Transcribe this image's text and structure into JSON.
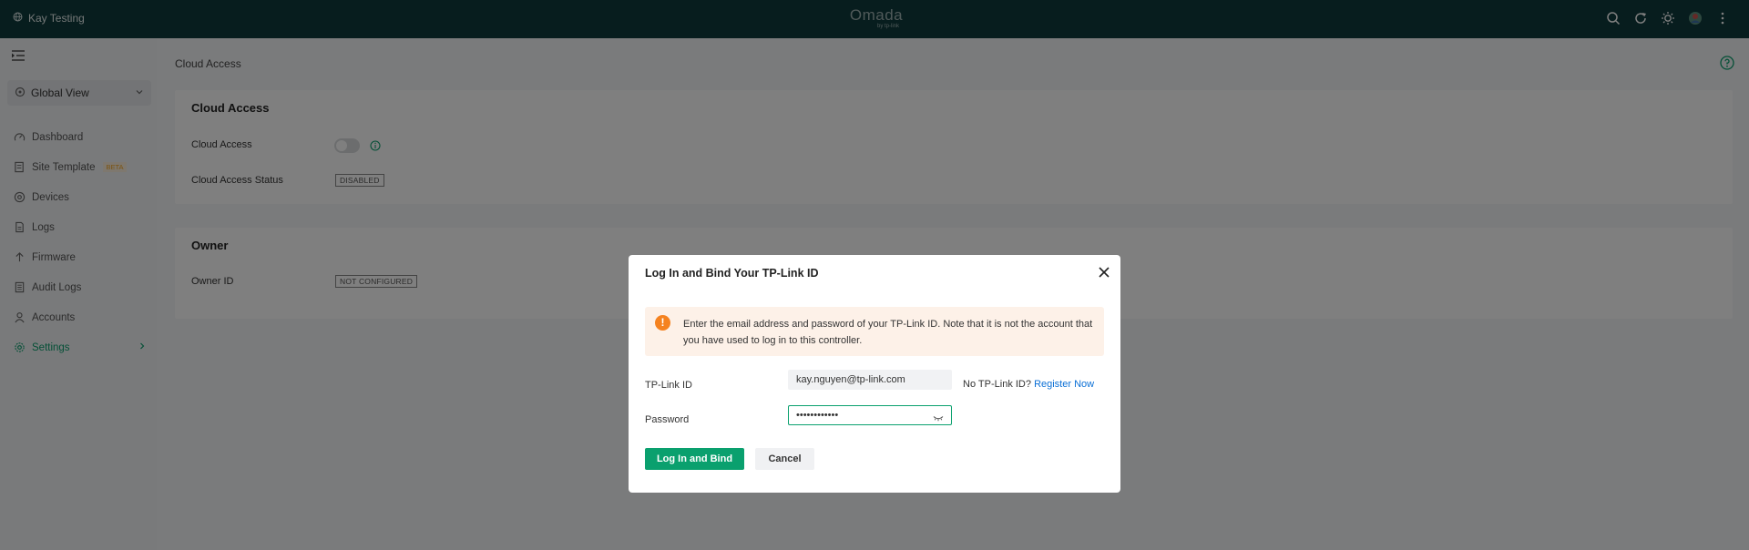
{
  "topbar": {
    "site_name": "Kay Testing",
    "logo": "Omada",
    "logo_sub": "by tp-link",
    "icons": [
      "search-icon",
      "refresh-icon",
      "theme-icon",
      "avatar",
      "more-icon"
    ]
  },
  "sidebar": {
    "global_view": "Global View",
    "items": [
      {
        "label": "Dashboard",
        "icon": "dashboard-icon"
      },
      {
        "label": "Site Template",
        "icon": "template-icon",
        "badge": "BETA"
      },
      {
        "label": "Devices",
        "icon": "devices-icon"
      },
      {
        "label": "Logs",
        "icon": "logs-icon"
      },
      {
        "label": "Firmware",
        "icon": "firmware-icon"
      },
      {
        "label": "Audit Logs",
        "icon": "audit-logs-icon"
      },
      {
        "label": "Accounts",
        "icon": "accounts-icon"
      },
      {
        "label": "Settings",
        "icon": "settings-icon",
        "active": true
      }
    ]
  },
  "main": {
    "page_title": "Cloud Access",
    "cloud_card": {
      "title": "Cloud Access",
      "cloud_access_label": "Cloud Access",
      "cloud_access_enabled": false,
      "status_label": "Cloud Access Status",
      "status_value": "DISABLED"
    },
    "owner_card": {
      "title": "Owner",
      "owner_label": "Owner ID",
      "owner_value": "NOT CONFIGURED"
    }
  },
  "modal": {
    "title": "Log In and Bind Your TP-Link ID",
    "alert_text": "Enter the email address and password of your TP-Link ID. Note that it is not the account that you have used to log in to this controller.",
    "id_label": "TP-Link ID",
    "id_value": "kay.nguyen@tp-link.com",
    "no_id_text": "No TP-Link ID?",
    "register_link": "Register Now",
    "password_label": "Password",
    "password_value": "••••••••••••",
    "primary_button": "Log In and Bind",
    "cancel_button": "Cancel"
  },
  "colors": {
    "topbar": "#0f3b3c",
    "accent": "#0aa06e",
    "warning": "#f5821f",
    "link": "#0a6fd6"
  }
}
